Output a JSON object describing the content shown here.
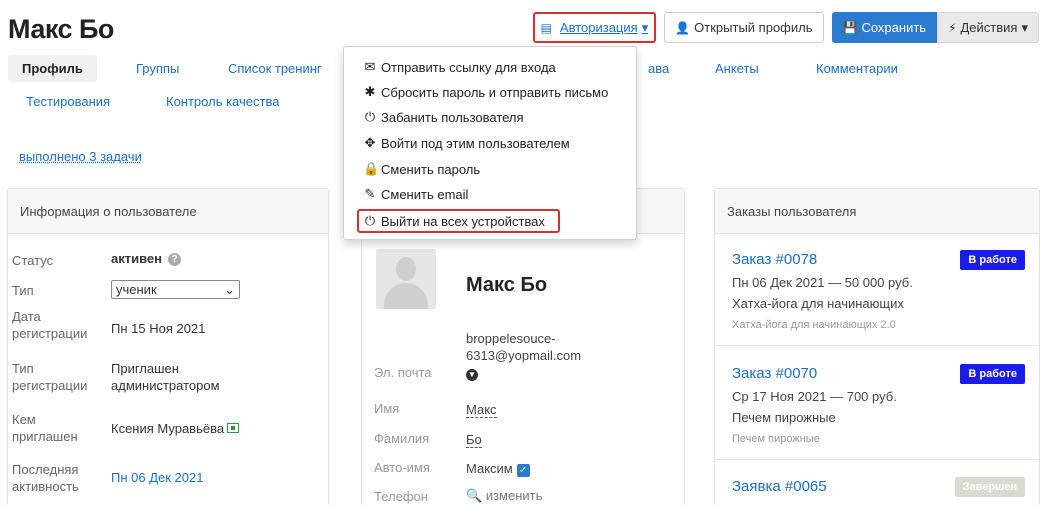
{
  "header": {
    "title": "Макс Бо",
    "auth_label": "Авторизация",
    "open_profile_label": "Открытый профиль",
    "save_label": "Сохранить",
    "actions_label": "Действия"
  },
  "tabs": [
    {
      "label": "Профиль"
    },
    {
      "label": "Группы"
    },
    {
      "label": "Список тренинг"
    },
    {
      "label": "ава"
    },
    {
      "label": "Анкеты"
    },
    {
      "label": "Комментарии"
    },
    {
      "label": "Тестирования"
    },
    {
      "label": "Контроль качества"
    }
  ],
  "tasks_link": "выполнено 3 задачи",
  "info_panel": {
    "title": "Информация о пользователе",
    "rows": [
      {
        "label": "Статус",
        "value": "активен"
      },
      {
        "label": "Тип",
        "value": "ученик"
      },
      {
        "label": "Дата регистрации",
        "value": "Пн 15 Ноя 2021"
      },
      {
        "label": "Тип регистрации",
        "value": "Приглашен администратором"
      },
      {
        "label": "Кем приглашен",
        "value": "Ксения Муравьёва"
      },
      {
        "label": "Последняя активность",
        "value": "Пн 06 Дек 2021"
      }
    ]
  },
  "user_panel": {
    "name": "Макс Бо",
    "email_label": "Эл. почта",
    "email_line1": "broppelesouce-",
    "email_line2": "6313@yopmail.com",
    "first_name_label": "Имя",
    "first_name": "Макс",
    "last_name_label": "Фамилия",
    "last_name": "Бо",
    "auto_name_label": "Авто-имя",
    "auto_name": "Максим",
    "phone_label": "Телефон",
    "phone_action": "изменить"
  },
  "orders_panel": {
    "title": "Заказы пользователя",
    "orders": [
      {
        "title": "Заказ #0078",
        "line1": "Пн 06 Дек 2021 — 50 000 руб.",
        "line2": "Хатха-йога для начинающих",
        "sub": "Хатха-йога для начинающих 2.0",
        "status": "В работе"
      },
      {
        "title": "Заказ #0070",
        "line1": "Ср 17 Ноя 2021 — 700 руб.",
        "line2": "Печем пирожные",
        "sub": "Печем пирожные",
        "status": "В работе"
      },
      {
        "title": "Заявка #0065",
        "status": "Завершен"
      }
    ]
  },
  "dropdown": {
    "items": [
      {
        "label": "Отправить ссылку для входа",
        "icon": "envelope-icon"
      },
      {
        "label": "Сбросить пароль и отправить письмо",
        "icon": "asterisk-icon"
      },
      {
        "label": "Забанить пользователя",
        "icon": "power-icon"
      },
      {
        "label": "Войти под этим пользователем",
        "icon": "move-icon"
      },
      {
        "label": "Сменить пароль",
        "icon": "lock-icon"
      },
      {
        "label": "Сменить email",
        "icon": "edit-icon"
      },
      {
        "label": "Выйти на всех устройствах",
        "icon": "power-icon"
      }
    ]
  },
  "colors": {
    "accent": "#2b7bd0",
    "link": "#1a6fc7",
    "highlight": "#d9302c",
    "badge_active": "#1c1ce8",
    "badge_done": "#d8dcd1"
  }
}
